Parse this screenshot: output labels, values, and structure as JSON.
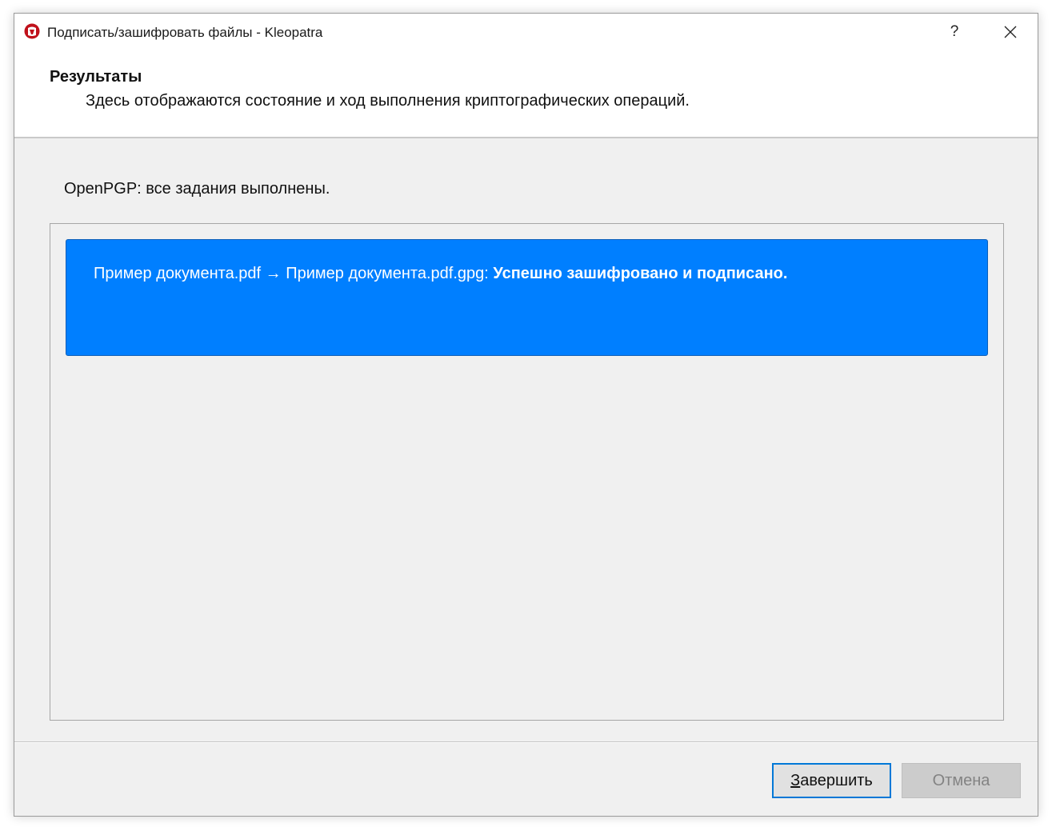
{
  "window": {
    "title": "Подписать/зашифровать файлы - Kleopatra",
    "help_glyph": "?",
    "close_glyph": "✕"
  },
  "header": {
    "title": "Результаты",
    "subtitle": "Здесь отображаются состояние и ход выполнения криптографических операций."
  },
  "status": {
    "text": "OpenPGP: все задания выполнены."
  },
  "results": [
    {
      "source_file": "Пример документа.pdf",
      "arrow": "→",
      "target_file": "Пример документа.pdf.gpg:",
      "message": "Успешно зашифровано и подписано.",
      "color": "#007fff"
    }
  ],
  "buttons": {
    "finish_first": "З",
    "finish_rest": "авершить",
    "cancel": "Отмена"
  },
  "colors": {
    "accent": "#0078d7",
    "success_card": "#007fff",
    "app_icon": "#c0111b"
  },
  "icons": {
    "app": "kleopatra-icon",
    "help": "help-icon",
    "close": "close-icon"
  }
}
